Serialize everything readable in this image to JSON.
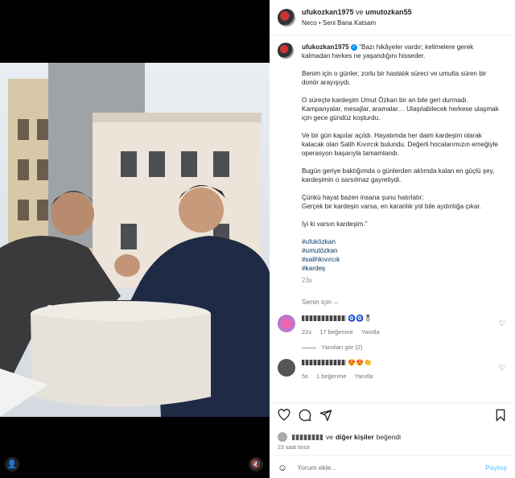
{
  "header": {
    "user1": "ufukozkan1975",
    "conjunction": "ve",
    "user2": "umutozkan55",
    "music": "Neco • Seni Bana Katsam"
  },
  "caption": {
    "username": "ufukozkan1975",
    "paragraphs": [
      "“Bazı hikâyeler vardır; kelimelere gerek kalmadan herkes ne yaşandığını hisseder.",
      "Benim için o günler, zorlu bir hastalık süreci ve umutla süren bir donör arayışıydı.",
      "O süreçte kardeşim Umut Özkan bir an bile geri durmadı. Kampanyalar, mesajlar, aramalar… Ulaşılabilecek herkese ulaşmak için gece gündüz koşturdu.",
      "Ve bir gün kapılar açıldı. Hayatımda her daim kardeşim olarak kalacak olan Salih Kıvırcık bulundu. Değerli hocalarımızın emeğiyle operasyon başarıyla tamamlandı.",
      "Bugün geriye baktığımda o günlerden aklımda kalan en güçlü şey, kardeşimin o sarsılmaz gayretiydi.",
      "Çünkü hayat bazen insana şunu hatırlatır:\nGerçek bir kardeşin varsa, en karanlık yol bile aydınlığa çıkar.",
      "İyi ki varsın kardeşim.”"
    ],
    "hashtags": [
      "#ufuközkan",
      "#umutözkan",
      "#salihkıvırcık",
      "#kardeş"
    ],
    "time": "23s"
  },
  "for_you": "Senin için ⌵",
  "comments": [
    {
      "time": "22s",
      "likes": "17 beğenme",
      "reply": "Yanıtla",
      "emoji": "🧿🧿🎖",
      "view_replies": "Yanıtları gör (2)"
    },
    {
      "time": "5s",
      "likes": "1 beğenme",
      "reply": "Yanıtla",
      "emoji": "😍😍👏"
    }
  ],
  "likes": {
    "and": "ve",
    "others": "diğer kişiler",
    "liked": "beğendi",
    "ago": "23 saat önce"
  },
  "comment_box": {
    "placeholder": "Yorum ekle...",
    "post": "Paylaş"
  },
  "icons": [
    "heart-icon",
    "comment-icon",
    "share-icon",
    "bookmark-icon",
    "emoji-icon",
    "user-tag-icon",
    "mute-icon"
  ]
}
